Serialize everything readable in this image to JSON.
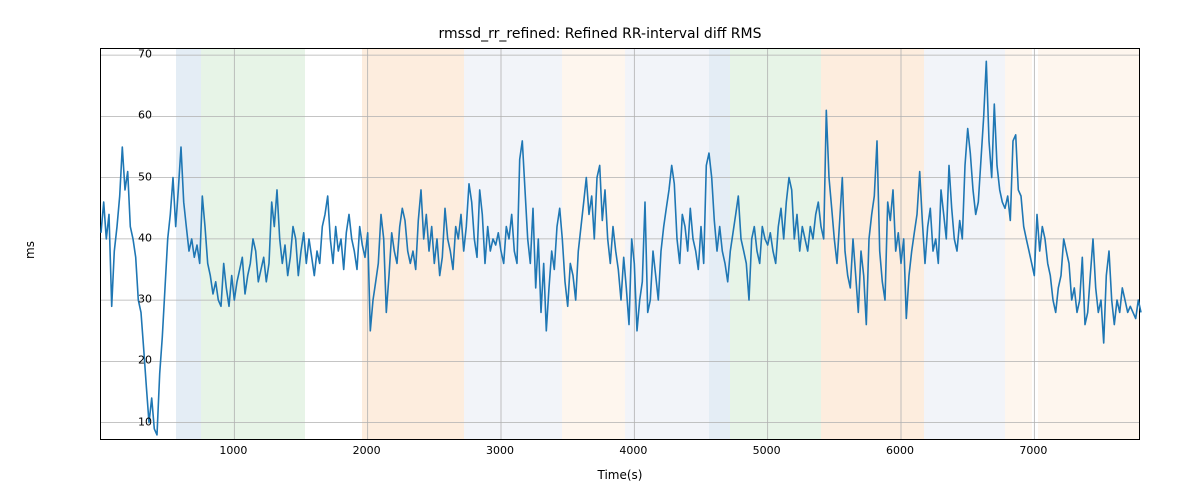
{
  "chart_data": {
    "type": "line",
    "title": "rmssd_rr_refined: Refined RR-interval diff RMS",
    "xlabel": "Time(s)",
    "ylabel": "ms",
    "xlim": [
      0,
      7800
    ],
    "ylim": [
      7,
      71
    ],
    "xticks": [
      1000,
      2000,
      3000,
      4000,
      5000,
      6000,
      7000
    ],
    "yticks": [
      10,
      20,
      30,
      40,
      50,
      60,
      70
    ],
    "spans": [
      {
        "x0": 560,
        "x1": 750,
        "color": "#9fbfdb"
      },
      {
        "x0": 750,
        "x1": 1530,
        "color": "#a8d8a8"
      },
      {
        "x0": 1960,
        "x1": 2720,
        "color": "#f9c089"
      },
      {
        "x0": 2720,
        "x1": 3460,
        "color": "#cfd9e8"
      },
      {
        "x0": 3460,
        "x1": 3930,
        "color": "#fbe0c3"
      },
      {
        "x0": 3930,
        "x1": 4560,
        "color": "#cfd9e8"
      },
      {
        "x0": 4560,
        "x1": 4720,
        "color": "#9fbfdb"
      },
      {
        "x0": 4720,
        "x1": 5400,
        "color": "#a8d8a8"
      },
      {
        "x0": 5400,
        "x1": 6170,
        "color": "#f9c089"
      },
      {
        "x0": 6170,
        "x1": 6780,
        "color": "#cfd9e8"
      },
      {
        "x0": 6780,
        "x1": 6980,
        "color": "#fbe0c3"
      },
      {
        "x0": 7030,
        "x1": 7800,
        "color": "#fbe0c3"
      }
    ],
    "x": [
      0,
      20,
      40,
      60,
      80,
      100,
      120,
      140,
      160,
      180,
      200,
      220,
      240,
      260,
      280,
      300,
      320,
      340,
      360,
      380,
      400,
      420,
      440,
      460,
      480,
      500,
      520,
      540,
      560,
      580,
      600,
      620,
      640,
      660,
      680,
      700,
      720,
      740,
      760,
      780,
      800,
      820,
      840,
      860,
      880,
      900,
      920,
      940,
      960,
      980,
      1000,
      1020,
      1040,
      1060,
      1080,
      1100,
      1120,
      1140,
      1160,
      1180,
      1200,
      1220,
      1240,
      1260,
      1280,
      1300,
      1320,
      1340,
      1360,
      1380,
      1400,
      1420,
      1440,
      1460,
      1480,
      1500,
      1520,
      1540,
      1560,
      1580,
      1600,
      1620,
      1640,
      1660,
      1680,
      1700,
      1720,
      1740,
      1760,
      1780,
      1800,
      1820,
      1840,
      1860,
      1880,
      1900,
      1920,
      1940,
      1960,
      1980,
      2000,
      2020,
      2040,
      2060,
      2080,
      2100,
      2120,
      2140,
      2160,
      2180,
      2200,
      2220,
      2240,
      2260,
      2280,
      2300,
      2320,
      2340,
      2360,
      2380,
      2400,
      2420,
      2440,
      2460,
      2480,
      2500,
      2520,
      2540,
      2560,
      2580,
      2600,
      2620,
      2640,
      2660,
      2680,
      2700,
      2720,
      2740,
      2760,
      2780,
      2800,
      2820,
      2840,
      2860,
      2880,
      2900,
      2920,
      2940,
      2960,
      2980,
      3000,
      3020,
      3040,
      3060,
      3080,
      3100,
      3120,
      3140,
      3160,
      3180,
      3200,
      3220,
      3240,
      3260,
      3280,
      3300,
      3320,
      3340,
      3360,
      3380,
      3400,
      3420,
      3440,
      3460,
      3480,
      3500,
      3520,
      3540,
      3560,
      3580,
      3600,
      3620,
      3640,
      3660,
      3680,
      3700,
      3720,
      3740,
      3760,
      3780,
      3800,
      3820,
      3840,
      3860,
      3880,
      3900,
      3920,
      3940,
      3960,
      3980,
      4000,
      4020,
      4040,
      4060,
      4080,
      4100,
      4120,
      4140,
      4160,
      4180,
      4200,
      4220,
      4240,
      4260,
      4280,
      4300,
      4320,
      4340,
      4360,
      4380,
      4400,
      4420,
      4440,
      4460,
      4480,
      4500,
      4520,
      4540,
      4560,
      4580,
      4600,
      4620,
      4640,
      4660,
      4680,
      4700,
      4720,
      4740,
      4760,
      4780,
      4800,
      4820,
      4840,
      4860,
      4880,
      4900,
      4920,
      4940,
      4960,
      4980,
      5000,
      5020,
      5040,
      5060,
      5080,
      5100,
      5120,
      5140,
      5160,
      5180,
      5200,
      5220,
      5240,
      5260,
      5280,
      5300,
      5320,
      5340,
      5360,
      5380,
      5400,
      5420,
      5440,
      5460,
      5480,
      5500,
      5520,
      5540,
      5560,
      5580,
      5600,
      5620,
      5640,
      5660,
      5680,
      5700,
      5720,
      5740,
      5760,
      5780,
      5800,
      5820,
      5840,
      5860,
      5880,
      5900,
      5920,
      5940,
      5960,
      5980,
      6000,
      6020,
      6040,
      6060,
      6080,
      6100,
      6120,
      6140,
      6160,
      6180,
      6200,
      6220,
      6240,
      6260,
      6280,
      6300,
      6320,
      6340,
      6360,
      6380,
      6400,
      6420,
      6440,
      6460,
      6480,
      6500,
      6520,
      6540,
      6560,
      6580,
      6600,
      6620,
      6640,
      6660,
      6680,
      6700,
      6720,
      6740,
      6760,
      6780,
      6800,
      6820,
      6840,
      6860,
      6880,
      6900,
      6920,
      6940,
      6960,
      6980,
      7000,
      7020,
      7040,
      7060,
      7080,
      7100,
      7120,
      7140,
      7160,
      7180,
      7200,
      7220,
      7240,
      7260,
      7280,
      7300,
      7320,
      7340,
      7360,
      7380,
      7400,
      7420,
      7440,
      7460,
      7480,
      7500,
      7520,
      7540,
      7560,
      7580,
      7600,
      7620,
      7640,
      7660,
      7680,
      7700,
      7720,
      7740,
      7760,
      7780,
      7800
    ],
    "values": [
      41,
      46,
      40,
      44,
      29,
      38,
      42,
      47,
      55,
      48,
      51,
      42,
      40,
      37,
      30,
      28,
      22,
      16,
      10,
      14,
      9,
      8,
      18,
      24,
      32,
      40,
      44,
      50,
      42,
      48,
      55,
      46,
      42,
      38,
      40,
      37,
      39,
      36,
      47,
      42,
      36,
      34,
      31,
      33,
      30,
      29,
      36,
      32,
      29,
      34,
      30,
      33,
      35,
      37,
      31,
      34,
      36,
      40,
      38,
      33,
      35,
      37,
      33,
      36,
      46,
      42,
      48,
      40,
      36,
      39,
      34,
      37,
      42,
      40,
      34,
      38,
      41,
      36,
      40,
      37,
      34,
      38,
      36,
      42,
      44,
      47,
      40,
      36,
      42,
      38,
      40,
      35,
      41,
      44,
      40,
      38,
      35,
      42,
      39,
      37,
      41,
      25,
      30,
      33,
      36,
      44,
      40,
      28,
      34,
      41,
      38,
      36,
      42,
      45,
      43,
      38,
      36,
      38,
      35,
      43,
      48,
      40,
      44,
      38,
      42,
      36,
      40,
      34,
      37,
      45,
      40,
      38,
      35,
      42,
      40,
      44,
      38,
      42,
      49,
      46,
      40,
      37,
      48,
      44,
      36,
      42,
      38,
      40,
      39,
      41,
      38,
      36,
      42,
      40,
      44,
      38,
      36,
      53,
      56,
      48,
      40,
      36,
      45,
      32,
      40,
      28,
      36,
      25,
      32,
      38,
      35,
      42,
      45,
      40,
      33,
      29,
      36,
      34,
      30,
      38,
      42,
      46,
      50,
      44,
      47,
      40,
      50,
      52,
      43,
      48,
      40,
      36,
      42,
      38,
      35,
      30,
      37,
      32,
      26,
      40,
      36,
      25,
      30,
      33,
      46,
      28,
      30,
      38,
      34,
      30,
      38,
      42,
      45,
      48,
      52,
      49,
      40,
      36,
      44,
      42,
      38,
      45,
      40,
      38,
      35,
      42,
      36,
      52,
      54,
      50,
      43,
      38,
      42,
      38,
      36,
      33,
      38,
      41,
      44,
      47,
      40,
      38,
      36,
      30,
      40,
      42,
      38,
      36,
      42,
      40,
      39,
      41,
      38,
      36,
      42,
      45,
      40,
      46,
      50,
      48,
      40,
      44,
      38,
      42,
      40,
      38,
      42,
      40,
      44,
      46,
      42,
      40,
      61,
      50,
      45,
      40,
      36,
      43,
      50,
      38,
      34,
      32,
      40,
      34,
      28,
      38,
      34,
      26,
      40,
      44,
      47,
      56,
      38,
      33,
      30,
      46,
      43,
      48,
      38,
      41,
      36,
      40,
      27,
      34,
      38,
      41,
      44,
      51,
      43,
      36,
      42,
      45,
      38,
      40,
      36,
      48,
      44,
      40,
      52,
      45,
      40,
      38,
      43,
      40,
      52,
      58,
      54,
      48,
      44,
      46,
      53,
      60,
      69,
      56,
      50,
      62,
      52,
      48,
      46,
      45,
      47,
      43,
      56,
      57,
      48,
      47,
      42,
      40,
      38,
      36,
      34,
      44,
      38,
      42,
      40,
      36,
      34,
      30,
      28,
      32,
      34,
      40,
      38,
      36,
      30,
      32,
      28,
      30,
      37,
      26,
      28,
      34,
      40,
      32,
      28,
      30,
      23,
      34,
      38,
      30,
      26,
      30,
      28,
      32,
      30,
      28,
      29,
      28,
      27,
      30,
      28
    ],
    "series_name": "rmssd_rr_refined"
  }
}
